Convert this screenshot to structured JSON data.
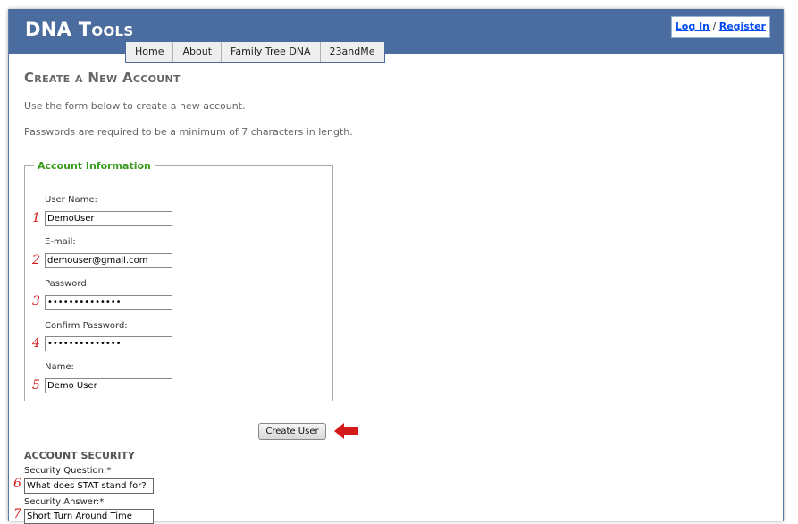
{
  "site": {
    "title": "DNA Tools"
  },
  "login": {
    "login_label": "Log In",
    "separator": "/",
    "register_label": "Register"
  },
  "menu": [
    {
      "label": "Home"
    },
    {
      "label": "About"
    },
    {
      "label": "Family Tree DNA"
    },
    {
      "label": "23andMe"
    }
  ],
  "page": {
    "heading": "Create a New Account",
    "intro1": "Use the form below to create a new account.",
    "intro2": "Passwords are required to be a minimum of 7 characters in length."
  },
  "account": {
    "legend": "Account Information",
    "fields": [
      {
        "marker": "1",
        "label": "User Name:",
        "value": "DemoUser"
      },
      {
        "marker": "2",
        "label": "E-mail:",
        "value": "demouser@gmail.com"
      },
      {
        "marker": "3",
        "label": "Password:",
        "value": "••••••••••••••"
      },
      {
        "marker": "4",
        "label": "Confirm Password:",
        "value": "••••••••••••••"
      },
      {
        "marker": "5",
        "label": "Name:",
        "value": "Demo User"
      }
    ],
    "submit_label": "Create User"
  },
  "security": {
    "heading": "ACCOUNT SECURITY",
    "question_label": "Security Question:*",
    "question_marker": "6",
    "question_value": "What does STAT stand for?",
    "answer_label": "Security Answer:*",
    "answer_marker": "7",
    "answer_value": "Short Turn Around Time"
  },
  "colors": {
    "header": "#4b6c9e",
    "legend": "#3a9a1e",
    "marker": "#d21a1a",
    "link": "#034af3"
  },
  "icons": {
    "annotation_arrow": "arrow-left-icon"
  }
}
